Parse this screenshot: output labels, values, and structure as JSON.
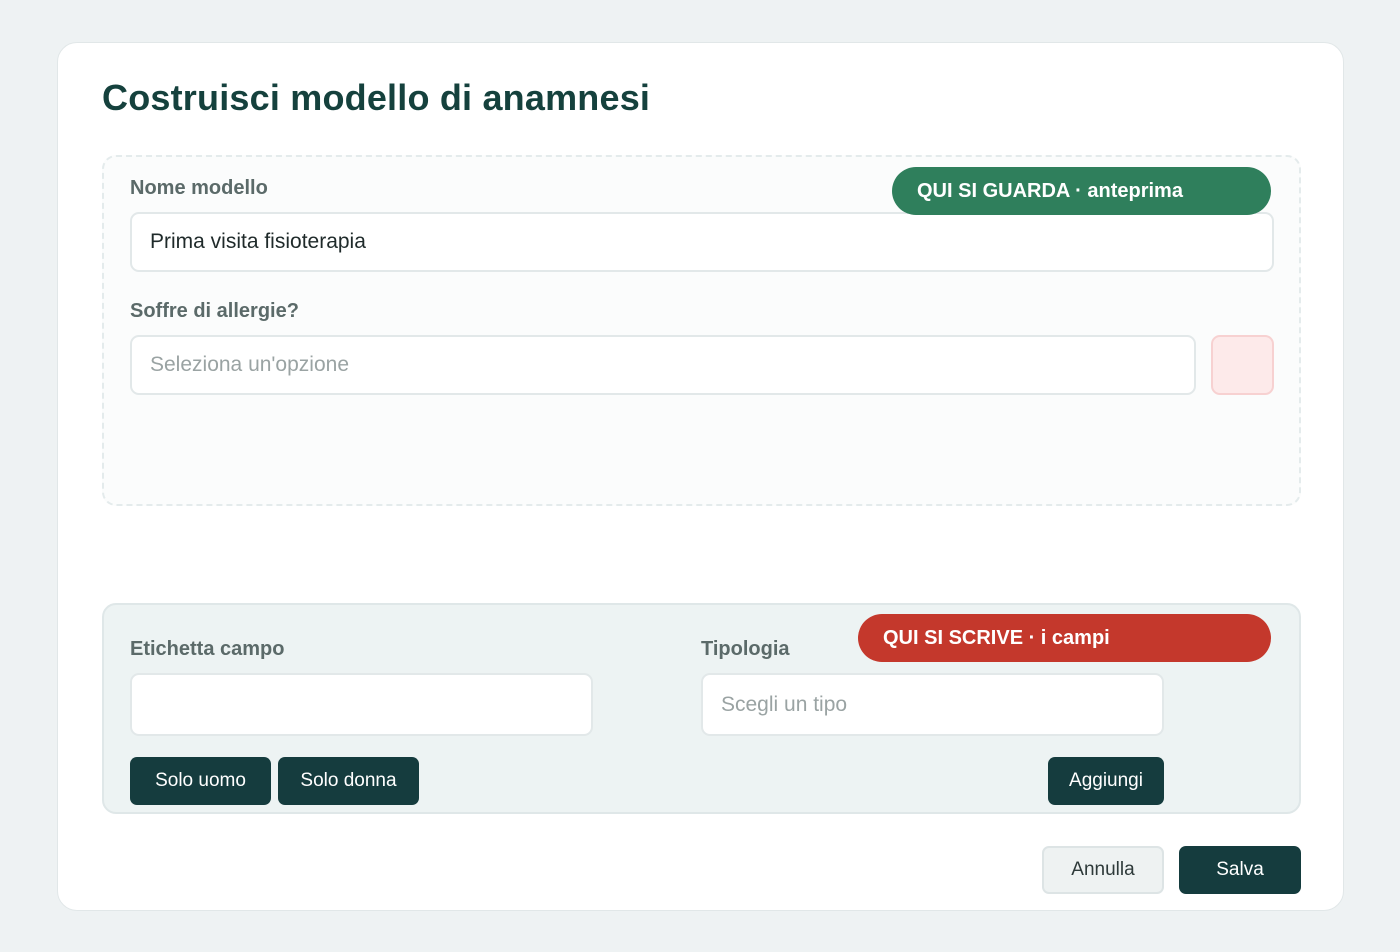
{
  "page": {
    "title": "Costruisci modello di anamnesi"
  },
  "preview": {
    "badge": "QUI SI GUARDA · anteprima",
    "name_label": "Nome modello",
    "name_value": "Prima visita fisioterapia",
    "question_label": "Soffre di allergie?",
    "question_placeholder": "Seleziona un'opzione"
  },
  "builder": {
    "badge": "QUI SI SCRIVE · i campi",
    "field_label": "Etichetta campo",
    "field_value": "",
    "type_label": "Tipologia",
    "type_placeholder": "Scegli un tipo",
    "only_male": "Solo uomo",
    "only_female": "Solo donna",
    "add": "Aggiungi"
  },
  "footer": {
    "cancel": "Annulla",
    "save": "Salva"
  },
  "colors": {
    "accent_dark": "#153c3e",
    "badge_green": "#2f7f5c",
    "badge_red": "#c4382c",
    "title": "#15413d"
  }
}
